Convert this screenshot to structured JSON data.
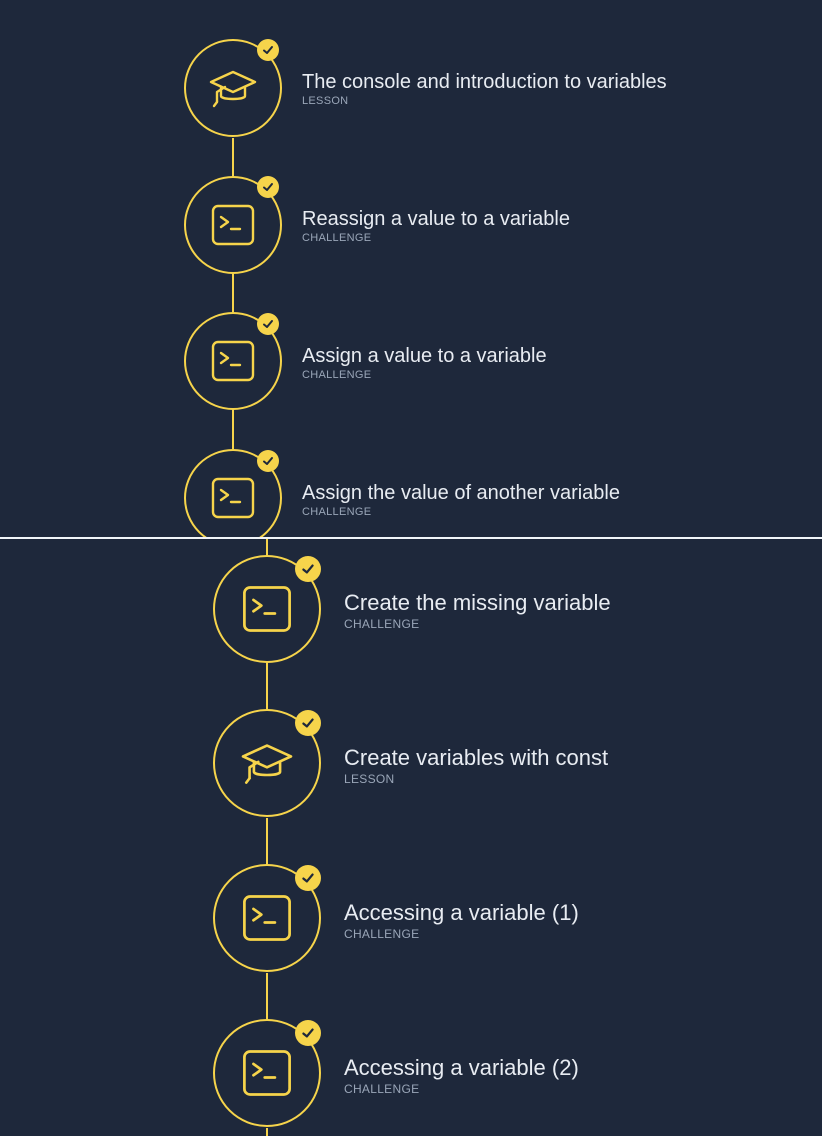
{
  "colors": {
    "background": "#1e283b",
    "accent": "#f6d44b",
    "title_text": "#e8ecf2",
    "type_text": "#9aa6b8"
  },
  "top_panel": {
    "steps": [
      {
        "title": "The console and introduction to variables",
        "type": "LESSON",
        "icon": "graduation-cap-icon",
        "completed": true
      },
      {
        "title": "Reassign a value to a variable",
        "type": "CHALLENGE",
        "icon": "terminal-icon",
        "completed": true
      },
      {
        "title": "Assign a value to a variable",
        "type": "CHALLENGE",
        "icon": "terminal-icon",
        "completed": true
      },
      {
        "title": "Assign the value of another variable",
        "type": "CHALLENGE",
        "icon": "terminal-icon",
        "completed": true
      }
    ]
  },
  "bottom_panel": {
    "steps": [
      {
        "title": "Create the missing variable",
        "type": "CHALLENGE",
        "icon": "terminal-icon",
        "completed": true
      },
      {
        "title": "Create variables with const",
        "type": "LESSON",
        "icon": "graduation-cap-icon",
        "completed": true
      },
      {
        "title": "Accessing a variable (1)",
        "type": "CHALLENGE",
        "icon": "terminal-icon",
        "completed": true
      },
      {
        "title": "Accessing a variable (2)",
        "type": "CHALLENGE",
        "icon": "terminal-icon",
        "completed": true
      }
    ]
  }
}
